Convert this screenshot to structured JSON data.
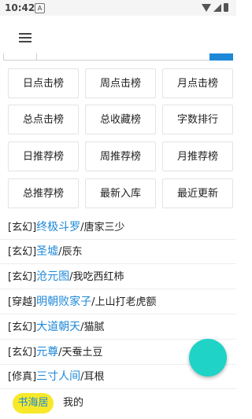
{
  "status_bar": {
    "time": "10:42",
    "notification_glyph": "A",
    "icons": [
      "notification-icon",
      "wifi-icon",
      "signal-icon",
      "battery-icon"
    ]
  },
  "toolbar": {
    "menu_icon": "hamburger-menu-icon"
  },
  "rankings": [
    "日点击榜",
    "周点击榜",
    "月点击榜",
    "总点击榜",
    "总收藏榜",
    "字数排行",
    "日推荐榜",
    "周推荐榜",
    "月推荐榜",
    "总推荐榜",
    "最新入库",
    "最近更新"
  ],
  "books": [
    {
      "genre": "[玄幻]",
      "title": "终极斗罗",
      "sep": "/",
      "author": "唐家三少"
    },
    {
      "genre": "[玄幻]",
      "title": "圣墟",
      "sep": "/",
      "author": "辰东"
    },
    {
      "genre": "[玄幻]",
      "title": "沧元图",
      "sep": "/",
      "author": "我吃西红柿"
    },
    {
      "genre": "[穿越]",
      "title": "明朝败家子",
      "sep": "/",
      "author": "上山打老虎额"
    },
    {
      "genre": "[玄幻]",
      "title": "大道朝天",
      "sep": "/",
      "author": "猫腻"
    },
    {
      "genre": "[玄幻]",
      "title": "元尊",
      "sep": "/",
      "author": "天蚕土豆"
    },
    {
      "genre": "[修真]",
      "title": "三寸人间",
      "sep": "/",
      "author": "耳根"
    }
  ],
  "bottom_nav": {
    "tab_1": "书海居",
    "tab_2": "我的"
  },
  "colors": {
    "accent": "#1e88d8",
    "fab": "#1fd3c6",
    "active_tab_bg": "#f7e92a"
  }
}
